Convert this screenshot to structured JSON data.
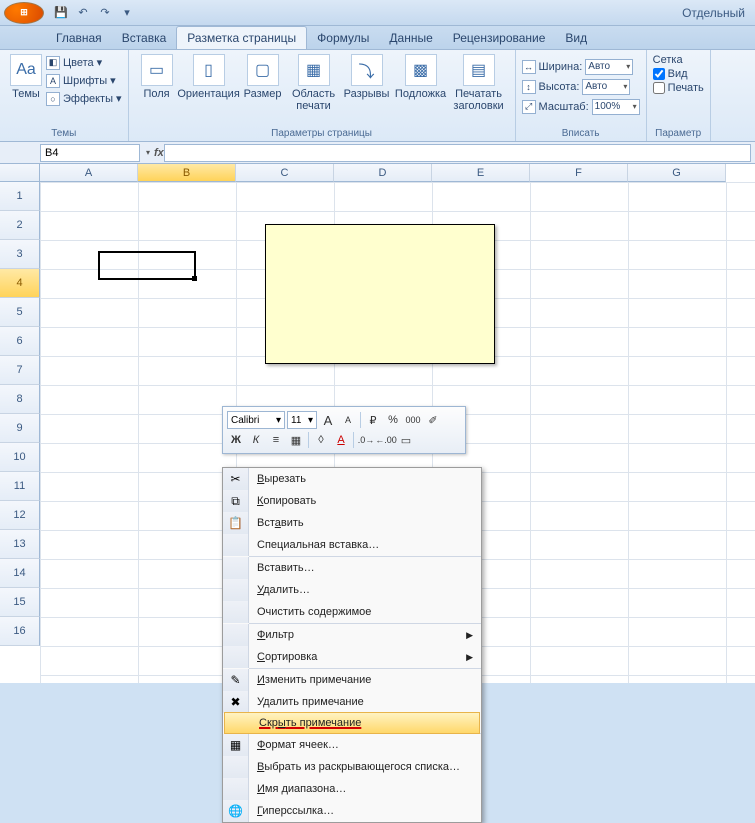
{
  "qat": {
    "title_right": "Отдельный"
  },
  "tabs": [
    "Главная",
    "Вставка",
    "Разметка страницы",
    "Формулы",
    "Данные",
    "Рецензирование",
    "Вид"
  ],
  "active_tab": 2,
  "ribbon": {
    "themes": {
      "label": "Темы",
      "dd": "▾",
      "colors": "Цвета",
      "fonts": "Шрифты",
      "effects": "Эффекты",
      "group_title": "Темы"
    },
    "page": {
      "margins": "Поля",
      "orientation": "Ориентация",
      "size": "Размер",
      "print_area": "Область печати",
      "breaks": "Разрывы",
      "background": "Подложка",
      "print_titles": "Печатать заголовки",
      "group_title": "Параметры страницы"
    },
    "fit": {
      "width_label": "Ширина:",
      "height_label": "Высота:",
      "scale_label": "Масштаб:",
      "width_val": "Авто",
      "height_val": "Авто",
      "scale_val": "100%",
      "group_title": "Вписать"
    },
    "gridlines": {
      "grid_title": "Сетка",
      "view_label": "Вид",
      "print_label": "Печать",
      "group_title": "Параметр"
    }
  },
  "formula": {
    "namebox": "B4",
    "fx": "fx"
  },
  "cols": [
    "A",
    "B",
    "C",
    "D",
    "E",
    "F",
    "G"
  ],
  "rows": [
    "1",
    "2",
    "3",
    "4",
    "5",
    "6",
    "7",
    "8",
    "9",
    "10",
    "11",
    "12",
    "13",
    "14",
    "15",
    "16"
  ],
  "sel_col_index": 1,
  "sel_row_index": 3,
  "mini": {
    "font": "Calibri",
    "size": "11",
    "growA": "A",
    "shrinkA": "A"
  },
  "ctx": [
    {
      "icon": "✂",
      "label": "Вырезать",
      "u": 0
    },
    {
      "icon": "⧉",
      "label": "Копировать",
      "u": 0
    },
    {
      "icon": "📋",
      "label": "Вставить",
      "u": 3
    },
    {
      "label": "Специальная вставка…"
    },
    {
      "divider": true
    },
    {
      "label": "Вставить…"
    },
    {
      "label": "Удалить…",
      "u": 0
    },
    {
      "label": "Очистить содержимое"
    },
    {
      "divider": true
    },
    {
      "label": "Фильтр",
      "u": 0,
      "submenu": true
    },
    {
      "label": "Сортировка",
      "u": 0,
      "submenu": true
    },
    {
      "divider": true
    },
    {
      "icon": "✎",
      "label": "Изменить примечание",
      "u": 0
    },
    {
      "icon": "✖",
      "label": "Удалить примечание"
    },
    {
      "label": "Скрыть примечание",
      "u": 3,
      "highlight": true,
      "red_underline": true
    },
    {
      "divider": true
    },
    {
      "icon": "▦",
      "label": "Формат ячеек…",
      "u": 0
    },
    {
      "label": "Выбрать из раскрывающегося списка…",
      "u": 0
    },
    {
      "label": "Имя диапазона…",
      "u": 0
    },
    {
      "icon": "🌐",
      "label": "Гиперссылка…",
      "u": 0
    }
  ]
}
